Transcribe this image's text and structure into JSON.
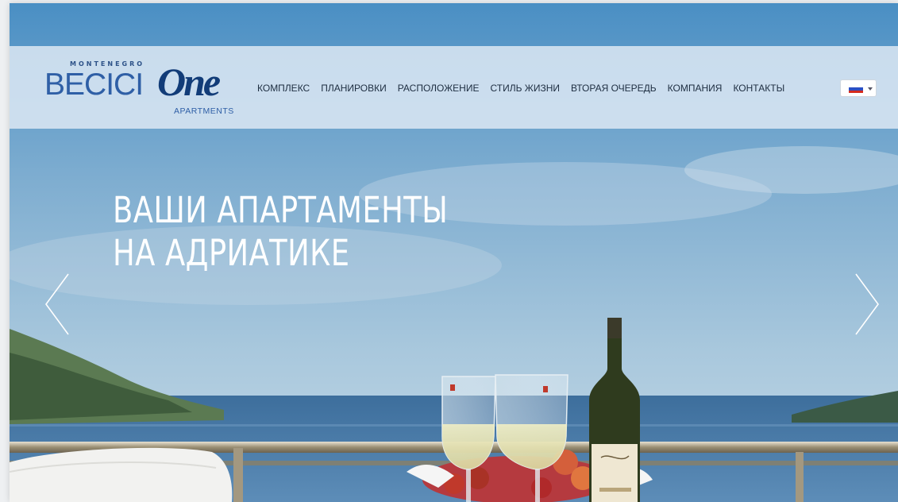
{
  "brand": {
    "top_line": "MONTENEGRO",
    "main": "BECICI",
    "script": "One",
    "sub": "APARTMENTS"
  },
  "nav": {
    "items": [
      {
        "label": "КОМПЛЕКС"
      },
      {
        "label": "ПЛАНИРОВКИ"
      },
      {
        "label": "РАСПОЛОЖЕНИЕ"
      },
      {
        "label": "СТИЛЬ ЖИЗНИ"
      },
      {
        "label": "ВТОРАЯ ОЧЕРЕДЬ"
      },
      {
        "label": "КОМПАНИЯ"
      },
      {
        "label": "КОНТАКТЫ"
      }
    ]
  },
  "language": {
    "selected_flag": "russia-flag-icon"
  },
  "hero": {
    "headline_line1": "ВАШИ АПАРТАМЕНТЫ",
    "headline_line2": "НА АДРИАТИКЕ"
  },
  "icons": {
    "prev": "chevron-left-icon",
    "next": "chevron-right-icon"
  },
  "colors": {
    "navbar_bg": "#dce8f3",
    "brand_blue": "#2f5fa6",
    "text_dark": "#1d2d40",
    "headline": "#ffffff"
  }
}
